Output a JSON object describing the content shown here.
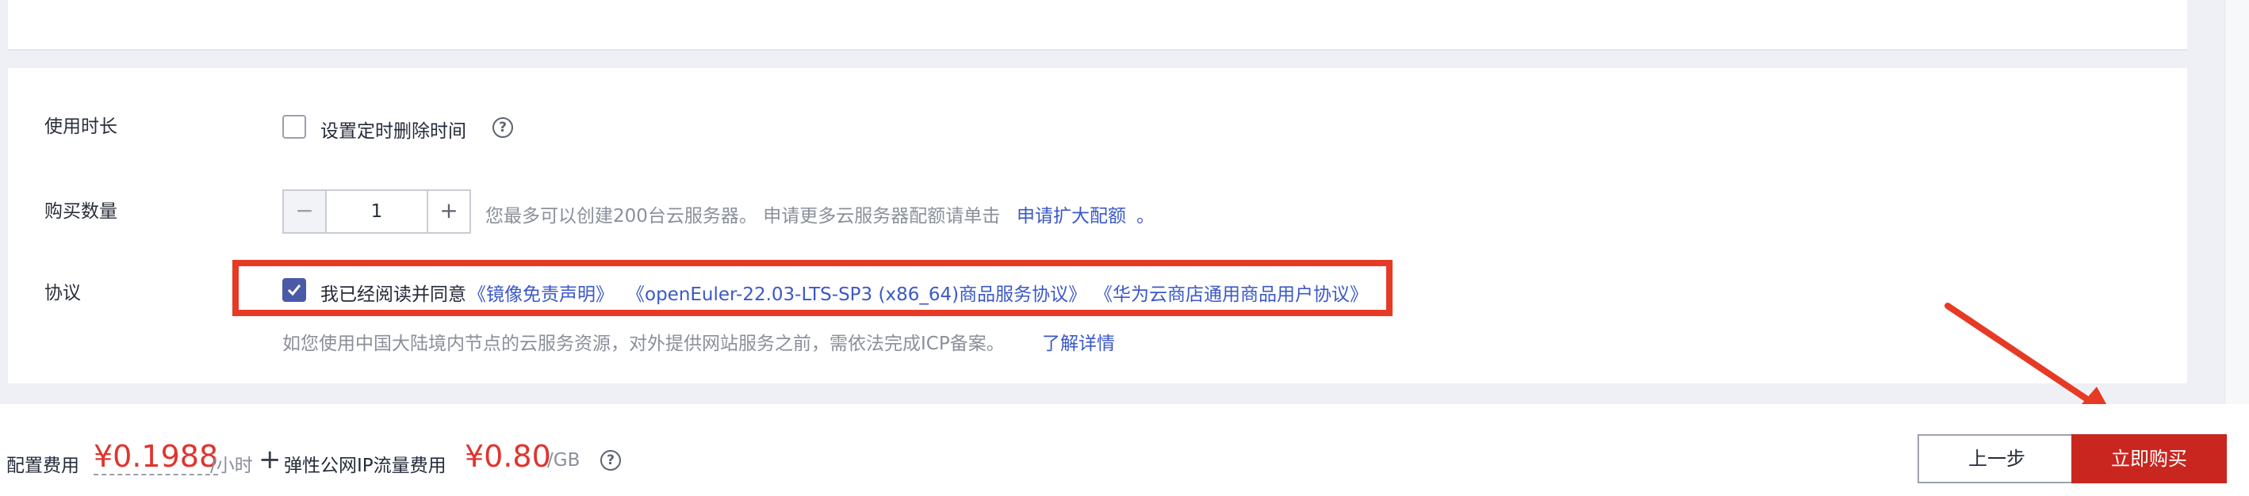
{
  "form": {
    "duration": {
      "label": "使用时长",
      "checkbox_label": "设置定时删除时间",
      "checked": false,
      "help_icon": "question-circle-icon"
    },
    "quantity": {
      "label": "购买数量",
      "value": "1",
      "hint": "您最多可以创建200台云服务器。 申请更多云服务器配额请单击",
      "link": "申请扩大配额",
      "suffix": "。"
    },
    "agreement": {
      "label": "协议",
      "checked": true,
      "prefix": "我已经阅读并同意",
      "link1": "《镜像免责声明》",
      "link2": "《openEuler-22.03-LTS-SP3 (x86_64)商品服务协议》",
      "link3": "《华为云商店通用商品用户协议》",
      "note": "如您使用中国大陆境内节点的云服务资源，对外提供网站服务之前，需依法完成ICP备案。",
      "note_link": "了解详情"
    }
  },
  "footer": {
    "config_label": "配置费用",
    "config_price": "¥0.1988",
    "config_unit": "/小时",
    "plus": "+",
    "ip_label": "弹性公网IP流量费用",
    "ip_price": "¥0.80",
    "ip_unit": "/GB",
    "help_icon": "question-circle-icon",
    "prev_button": "上一步",
    "buy_button": "立即购买"
  },
  "colors": {
    "accent_red": "#c8261f",
    "price_red": "#e0342e",
    "link_blue": "#3b59c7",
    "annotation_red": "#e63a25"
  }
}
